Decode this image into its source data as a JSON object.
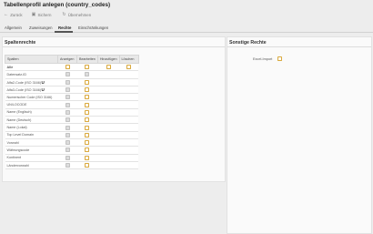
{
  "page": {
    "title": "Tabellenprofil anlegen (country_codes)"
  },
  "toolbar": [
    {
      "icon": "back-arrow-icon",
      "glyph": "←",
      "label": "Zurück"
    },
    {
      "icon": "save-icon",
      "glyph": "▣",
      "label": "Sichern"
    },
    {
      "icon": "refresh-icon",
      "glyph": "↻",
      "label": "Übernehmen"
    }
  ],
  "tabs": [
    {
      "label": "Allgemein",
      "active": false
    },
    {
      "label": "Zuweisungen",
      "active": false
    },
    {
      "label": "Rechte",
      "active": true
    },
    {
      "label": "Einschränkungen",
      "active": false
    }
  ],
  "column_rights": {
    "heading": "Spaltenrechte",
    "headers": [
      "Spalten",
      "Anzeigen",
      "Bearbeiten",
      "Hinzufügen",
      "Löschen"
    ],
    "all_row": {
      "label": "Alle",
      "anzeigen": "on",
      "bearbeiten": "on",
      "hinzufuegen": "on",
      "loeschen": "on"
    },
    "rows": [
      {
        "label": "Datensatz-ID",
        "anzeigen": "off",
        "bearbeiten": "off"
      },
      {
        "label": "Alfa2-Code (ISO 3166)",
        "marker": "U",
        "anzeigen": "off",
        "bearbeiten": "on"
      },
      {
        "label": "Alfa3-Code (ISO 3166)",
        "marker": "U",
        "anzeigen": "off",
        "bearbeiten": "on"
      },
      {
        "label": "Numerischer Code (ISO 3166)",
        "anzeigen": "off",
        "bearbeiten": "on"
      },
      {
        "label": "UN/LOCODE",
        "anzeigen": "off",
        "bearbeiten": "on"
      },
      {
        "label": "Name (Englisch)",
        "anzeigen": "off",
        "bearbeiten": "on"
      },
      {
        "label": "Name (Deutsch)",
        "anzeigen": "off",
        "bearbeiten": "on"
      },
      {
        "label": "Name (Lokal)",
        "anzeigen": "off",
        "bearbeiten": "on"
      },
      {
        "label": "Top Level Domain",
        "anzeigen": "off",
        "bearbeiten": "on"
      },
      {
        "label": "Vorwahl",
        "anzeigen": "off",
        "bearbeiten": "on"
      },
      {
        "label": "Währungscode",
        "anzeigen": "off",
        "bearbeiten": "on"
      },
      {
        "label": "Kontinent",
        "anzeigen": "off",
        "bearbeiten": "on"
      },
      {
        "label": "Ländervorwahl",
        "anzeigen": "off",
        "bearbeiten": "on"
      }
    ]
  },
  "other_rights": {
    "heading": "Sonstige Rechte",
    "items": [
      {
        "label": "Excel-Import",
        "state": "on"
      }
    ]
  },
  "colors": {
    "checkbox_on_border": "#d9a93e",
    "checkbox_off_fill": "#dcdcdc",
    "background": "#ededed",
    "panel": "#fafafa"
  }
}
